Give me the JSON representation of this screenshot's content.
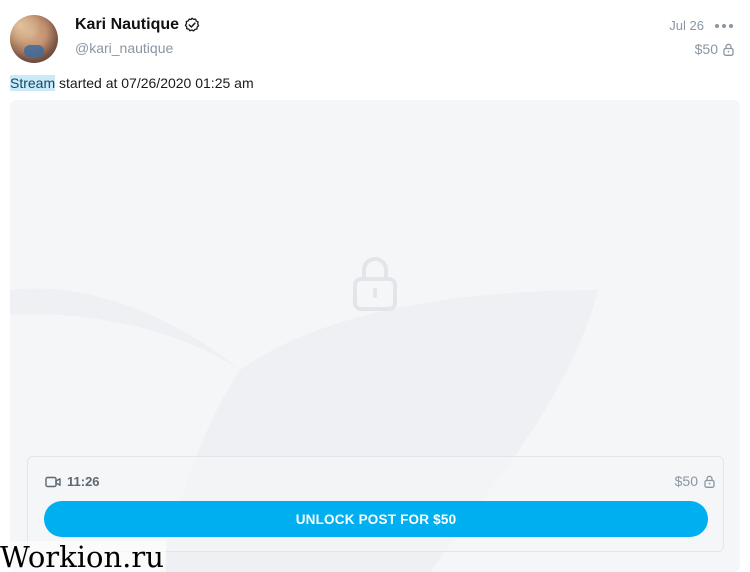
{
  "author": {
    "name": "Kari Nautique",
    "handle": "@kari_nautique",
    "verified": true
  },
  "post": {
    "date": "Jul 26",
    "price": "$50",
    "text_highlight": "Stream",
    "text_rest": " started at 07/26/2020 01:25 am",
    "media": {
      "duration": "11:26",
      "price": "$50",
      "unlock_label": "UNLOCK POST FOR $50"
    }
  },
  "icons": {
    "verified": "verified-check-icon",
    "more": "more-dots-icon",
    "lock": "lock-icon",
    "video": "video-camera-icon"
  },
  "colors": {
    "accent": "#00aff0",
    "muted": "#8a96a3",
    "highlight": "#cce9f7"
  },
  "watermark": "Workion.ru"
}
